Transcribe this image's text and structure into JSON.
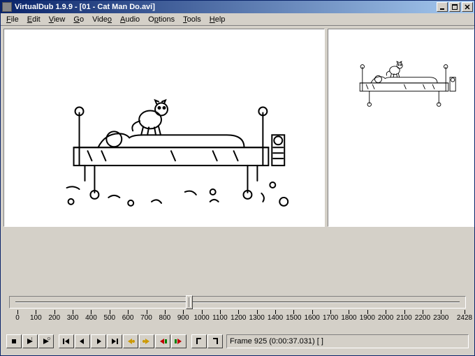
{
  "titlebar": {
    "title": "VirtualDub 1.9.9 - [01 - Cat Man Do.avi]"
  },
  "menu": {
    "items": [
      "File",
      "Edit",
      "View",
      "Go",
      "Video",
      "Audio",
      "Options",
      "Tools",
      "Help"
    ]
  },
  "timeline": {
    "min": 0,
    "max": 2428,
    "position": 925,
    "ticks": [
      0,
      100,
      200,
      300,
      400,
      500,
      600,
      700,
      800,
      900,
      1000,
      1100,
      1200,
      1300,
      1400,
      1500,
      1600,
      1700,
      1800,
      1900,
      2000,
      2100,
      2200,
      2300,
      2428
    ]
  },
  "status": {
    "text": "Frame 925 (0:00:37.031) [ ]"
  },
  "icons": {
    "stop": "stop-icon",
    "play_in": "play-input-icon",
    "play_out": "play-output-icon",
    "seek_start": "seek-start-icon",
    "step_back": "step-back-icon",
    "step_fwd": "step-forward-icon",
    "seek_end": "seek-end-icon",
    "key_prev": "key-prev-icon",
    "key_next": "key-next-icon",
    "scene_prev": "scene-prev-icon",
    "scene_next": "scene-next-icon",
    "mark_in": "mark-in-icon",
    "mark_out": "mark-out-icon"
  },
  "colors": {
    "title_grad_a": "#0a246a",
    "title_grad_b": "#a6caf0",
    "face": "#d4d0c8"
  }
}
